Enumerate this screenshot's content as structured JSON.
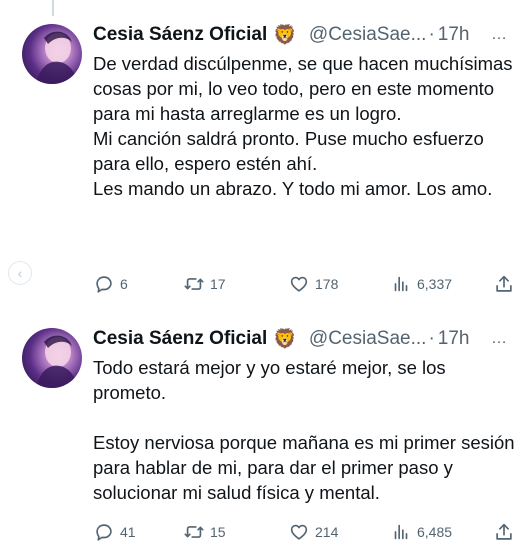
{
  "side_nav": {
    "icon": "chevron-left-icon",
    "glyph": "‹"
  },
  "tweets": [
    {
      "author": {
        "name": "Cesia Sáenz Oficial",
        "badge": "🦁",
        "handle": "@CesiaSae...",
        "time_sep": "·",
        "time": "17h"
      },
      "more_label": "…",
      "lines": [
        "De verdad discúlpenme, se que hacen muchísimas cosas por mi, lo veo todo, pero en este momento para mi hasta arreglarme es un logro.",
        "Mi canción saldrá pronto. Puse mucho esfuerzo para ello, espero estén ahí.",
        "Les mando un abrazo. Y todo mi amor. Los amo."
      ],
      "stats": {
        "replies": "6",
        "retweets": "17",
        "likes": "178",
        "views": "6,337"
      }
    },
    {
      "author": {
        "name": "Cesia Sáenz Oficial",
        "badge": "🦁",
        "handle": "@CesiaSae...",
        "time_sep": "·",
        "time": "17h"
      },
      "more_label": "…",
      "lines": [
        "Todo estará mejor y yo estaré mejor, se los prometo.",
        "",
        "Estoy nerviosa porque mañana es mi primer sesión para hablar de mi, para dar el primer paso y solucionar mi salud física y mental."
      ],
      "stats": {
        "replies": "41",
        "retweets": "15",
        "likes": "214",
        "views": "6,485"
      }
    }
  ],
  "icons": {
    "reply": "reply-bubble-icon",
    "retweet": "retweet-arrows-icon",
    "like": "heart-icon",
    "views": "views-bars-icon",
    "share": "share-upload-icon"
  },
  "colors": {
    "text": "#0f1419",
    "secondary": "#536471",
    "thread_line": "#cfd9de"
  }
}
